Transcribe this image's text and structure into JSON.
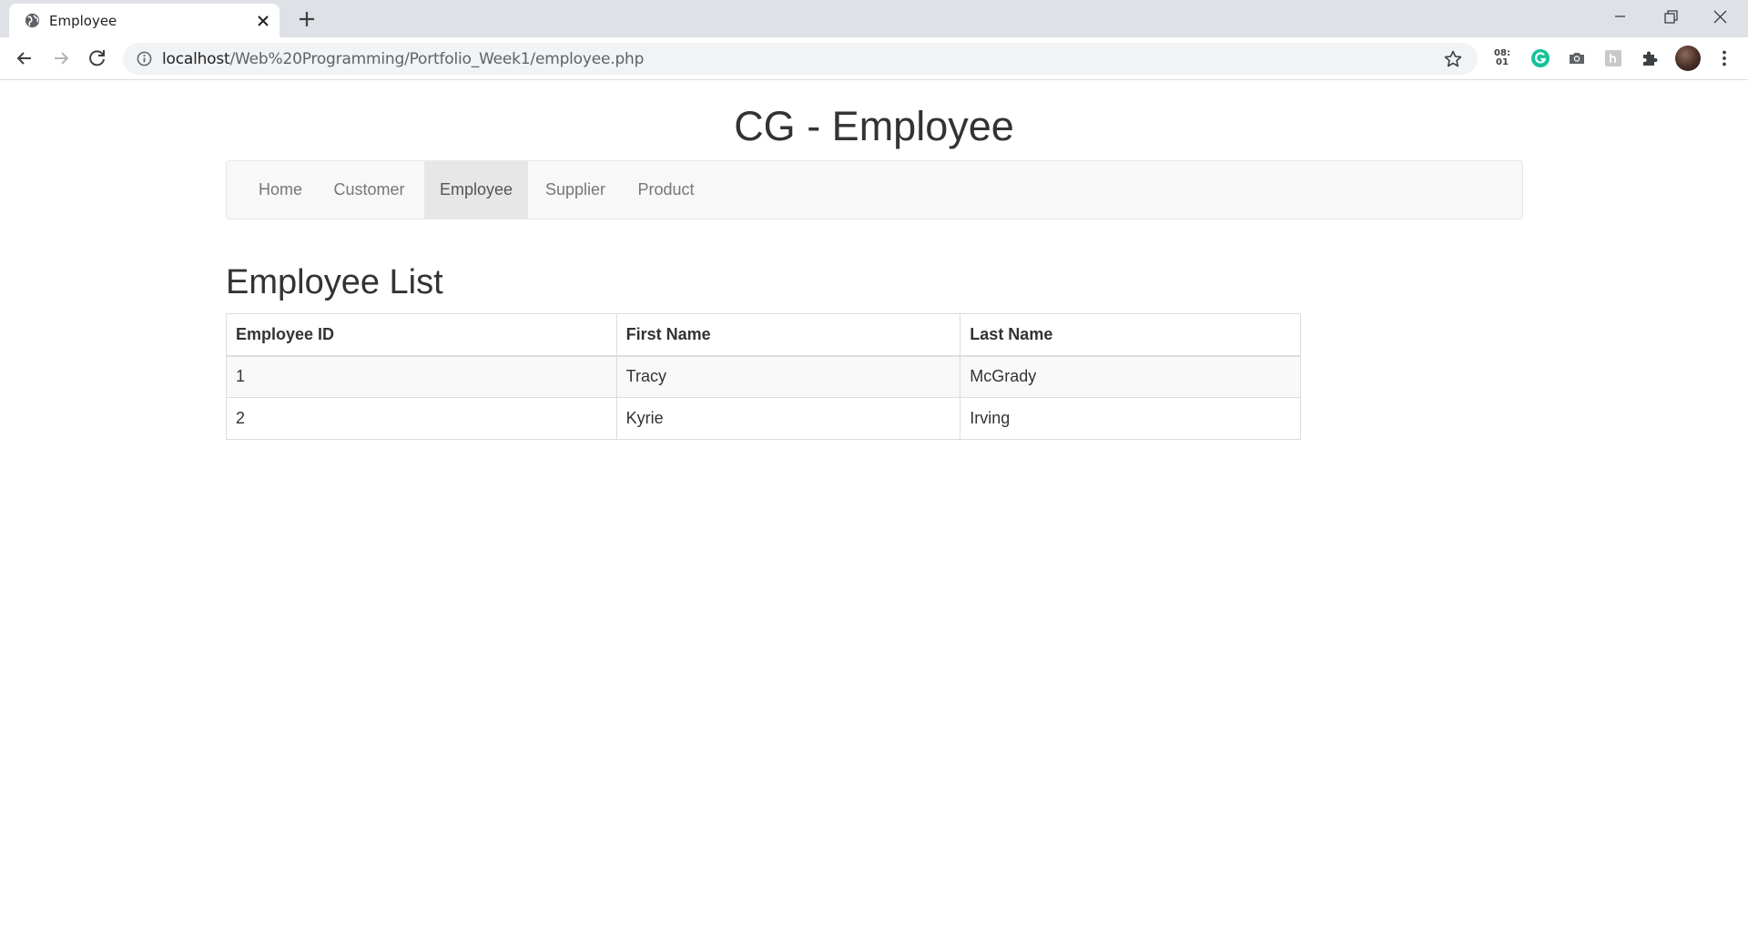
{
  "browser": {
    "tab_title": "Employee",
    "url_host": "localhost",
    "url_path": "/Web%20Programming/Portfolio_Week1/employee.php",
    "clock_extension": {
      "line1": "08:",
      "line2": "01"
    },
    "icons": [
      "globe-icon",
      "close-icon",
      "plus-icon",
      "minimize-icon",
      "maximize-icon",
      "window-close-icon",
      "back-arrow-icon",
      "forward-arrow-icon",
      "reload-icon",
      "info-icon",
      "star-icon",
      "grammarly-icon",
      "camera-icon",
      "puzzle-icon",
      "menu-dots-icon"
    ]
  },
  "page": {
    "site_title": "CG - Employee",
    "nav": [
      {
        "label": "Home",
        "active": false
      },
      {
        "label": "Customer",
        "active": false
      },
      {
        "label": "Employee",
        "active": true
      },
      {
        "label": "Supplier",
        "active": false
      },
      {
        "label": "Product",
        "active": false
      }
    ],
    "section_title": "Employee List",
    "table": {
      "headers": [
        "Employee ID",
        "First Name",
        "Last Name"
      ],
      "rows": [
        [
          "1",
          "Tracy",
          "McGrady"
        ],
        [
          "2",
          "Kyrie",
          "Irving"
        ]
      ]
    }
  },
  "colors": {
    "tabstrip": "#dee1e6",
    "navbar_bg": "#f8f8f8",
    "nav_active_bg": "#e7e7e7",
    "grammarly_green": "#15c39a"
  }
}
